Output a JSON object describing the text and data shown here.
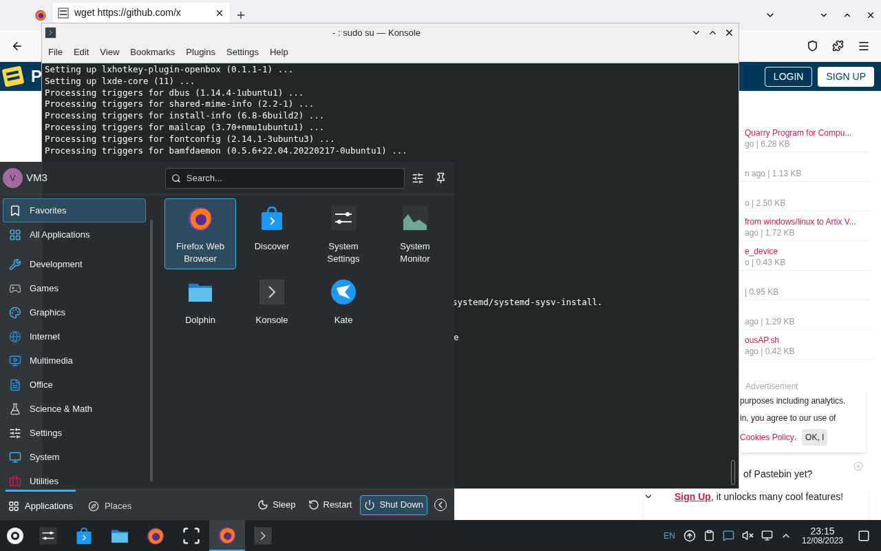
{
  "browser": {
    "tab": {
      "title": "wget https://github.com/x",
      "selected": true
    },
    "site": {
      "logo_letter": "P",
      "login": "LOGIN",
      "signup": "SIGN UP"
    },
    "pastes": [
      {
        "title": "Quarry Program for Compu...",
        "meta": "go | 6.28 KB"
      },
      {
        "meta": "n ago | 1.13 KB"
      },
      {
        "meta": "o | 2.50 KB"
      },
      {
        "title": "from windows/linux to Artix V...",
        "meta": "ago | 1.72 KB"
      },
      {
        "title": "e_device",
        "meta": "o | 0.43 KB"
      },
      {
        "meta": "| 0.95 KB"
      },
      {
        "meta": "ago | 1.29 KB"
      },
      {
        "title": "ousAP.sh",
        "meta": "ago | 0.42 KB"
      }
    ],
    "advertisement": "Advertisement",
    "cookie": {
      "line1": "purposes including analytics.",
      "line2": "in, you agree to our use of",
      "link": "Cookies Policy",
      "after": ".",
      "button": "OK, I"
    },
    "signup_popup": {
      "line1": "of Pastebin yet?",
      "link": "Sign Up",
      "rest": ", it unlocks many cool features!"
    }
  },
  "konsole": {
    "title": "- : sudo su — Konsole",
    "menu": [
      "File",
      "Edit",
      "View",
      "Bookmarks",
      "Plugins",
      "Settings",
      "Help"
    ],
    "lines": [
      "Setting up lxhotkey-plugin-openbox (0.1.1-1) ...",
      "Setting up lxde-core (11) ...",
      "Processing triggers for dbus (1.14.4-1ubuntu1) ...",
      "Processing triggers for shared-mime-info (2.2-1) ...",
      "Processing triggers for install-info (6.8-6build2) ...",
      "Processing triggers for mailcap (3.70+nmu1ubuntu1) ...",
      "Processing triggers for fontconfig (2.14.1-3ubuntu3) ...",
      "Processing triggers for bamfdaemon (0.5.6+22.04.20220217-0ubuntu1) ..."
    ],
    "fragments": [
      {
        "text": "systemd/systemd-sysv-install."
      },
      {
        "text": "e"
      }
    ]
  },
  "launcher": {
    "user": {
      "initial": "V",
      "name": "VM3"
    },
    "search": {
      "placeholder": "Search..."
    },
    "categories": [
      {
        "label": "Favorites",
        "selected": true
      },
      {
        "label": "All Applications",
        "selected": false
      },
      {
        "label": "Development",
        "selected": false
      },
      {
        "label": "Games",
        "selected": false
      },
      {
        "label": "Graphics",
        "selected": false
      },
      {
        "label": "Internet",
        "selected": false
      },
      {
        "label": "Multimedia",
        "selected": false
      },
      {
        "label": "Office",
        "selected": false
      },
      {
        "label": "Science & Math",
        "selected": false
      },
      {
        "label": "Settings",
        "selected": false
      },
      {
        "label": "System",
        "selected": false
      },
      {
        "label": "Utilities",
        "selected": false
      }
    ],
    "apps": [
      {
        "kind": "firefox",
        "label": "Firefox Web Browser",
        "selected": true
      },
      {
        "kind": "discover",
        "label": "Discover",
        "selected": false
      },
      {
        "kind": "settings",
        "label": "System Settings",
        "selected": false
      },
      {
        "kind": "monitor",
        "label": "System Monitor",
        "selected": false
      },
      {
        "kind": "dolphin",
        "label": "Dolphin",
        "selected": false
      },
      {
        "kind": "konsole",
        "label": "Konsole",
        "selected": false
      },
      {
        "kind": "kate",
        "label": "Kate",
        "selected": false
      }
    ],
    "tabs": [
      {
        "label": "Applications",
        "selected": true
      },
      {
        "label": "Places",
        "selected": false
      }
    ],
    "power": [
      {
        "kind": "sleep",
        "label": "Sleep",
        "highlighted": false
      },
      {
        "kind": "restart",
        "label": "Restart",
        "highlighted": false
      },
      {
        "kind": "shutdown",
        "label": "Shut Down",
        "highlighted": true
      }
    ]
  },
  "taskbar": {
    "tasks": [
      {
        "kind": "settings",
        "active": false
      },
      {
        "kind": "discover",
        "active": false
      },
      {
        "kind": "dolphin",
        "active": false
      },
      {
        "kind": "firefox",
        "active": false
      },
      {
        "kind": "overview",
        "active": false
      },
      {
        "kind": "firefox",
        "active": true
      },
      {
        "kind": "konsole",
        "active": false
      }
    ],
    "language": "EN",
    "time": "23:15",
    "date": "12/08/2023"
  }
}
